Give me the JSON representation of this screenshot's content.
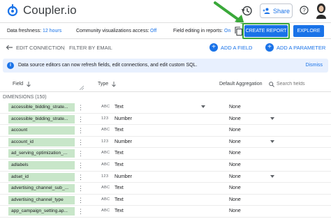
{
  "app": {
    "title": "Coupler.io"
  },
  "header": {
    "share_label": "Share"
  },
  "toolbar": {
    "freshness_label": "Data freshness:",
    "freshness_value": "12 hours",
    "community_label": "Community visualizations access:",
    "community_value": "Off",
    "field_editing_label": "Field editing in reports:",
    "field_editing_value": "On",
    "create_report_label": "CREATE REPORT",
    "explore_label": "EXPLORE"
  },
  "editbar": {
    "edit_connection_label": "EDIT CONNECTION",
    "filter_label": "FILTER BY EMAIL",
    "add_field_label": "ADD A FIELD",
    "add_parameter_label": "ADD A PARAMETER"
  },
  "banner": {
    "message": "Data source editors can now refresh fields, edit connections, and edit custom SQL.",
    "dismiss_label": "Dismiss"
  },
  "table": {
    "col_field": "Field",
    "col_type": "Type",
    "col_aggregation": "Default Aggregation",
    "search_placeholder": "Search fields",
    "dimensions_label": "DIMENSIONS (150)",
    "rows": [
      {
        "field": "accessible_bidding_strate...",
        "type_icon": "ABC",
        "type": "Text",
        "has_type_dropdown": true,
        "agg": "None",
        "has_agg_dropdown": false
      },
      {
        "field": "accessible_bidding_strate...",
        "type_icon": "123",
        "type": "Number",
        "has_type_dropdown": false,
        "agg": "None",
        "has_agg_dropdown": true
      },
      {
        "field": "account",
        "type_icon": "ABC",
        "type": "Text",
        "has_type_dropdown": false,
        "agg": "None",
        "has_agg_dropdown": false
      },
      {
        "field": "account_id",
        "type_icon": "123",
        "type": "Number",
        "has_type_dropdown": false,
        "agg": "None",
        "has_agg_dropdown": true
      },
      {
        "field": "ad_serving_optimization_...",
        "type_icon": "ABC",
        "type": "Text",
        "has_type_dropdown": false,
        "agg": "None",
        "has_agg_dropdown": false
      },
      {
        "field": "adlabels",
        "type_icon": "ABC",
        "type": "Text",
        "has_type_dropdown": false,
        "agg": "None",
        "has_agg_dropdown": false
      },
      {
        "field": "adset_id",
        "type_icon": "123",
        "type": "Number",
        "has_type_dropdown": false,
        "agg": "None",
        "has_agg_dropdown": true
      },
      {
        "field": "advertising_channel_sub_...",
        "type_icon": "ABC",
        "type": "Text",
        "has_type_dropdown": false,
        "agg": "None",
        "has_agg_dropdown": false
      },
      {
        "field": "advertising_channel_type",
        "type_icon": "ABC",
        "type": "Text",
        "has_type_dropdown": false,
        "agg": "None",
        "has_agg_dropdown": false
      },
      {
        "field": "app_campaign_setting.ap...",
        "type_icon": "ABC",
        "type": "Text",
        "has_type_dropdown": false,
        "agg": "None",
        "has_agg_dropdown": false
      }
    ]
  },
  "colors": {
    "accent": "#1a73e8",
    "chip": "#c8e6c9",
    "highlight": "#3aa83a",
    "banner": "#e8f0fe"
  },
  "icons": [
    "coupler-logo-icon",
    "history-icon",
    "add-person-icon",
    "help-icon",
    "avatar",
    "copy-icon",
    "back-arrow-icon",
    "plus-icon",
    "info-icon",
    "sort-arrow-icon",
    "search-icon",
    "more-vert-icon",
    "dropdown-icon",
    "annotation-arrow"
  ]
}
